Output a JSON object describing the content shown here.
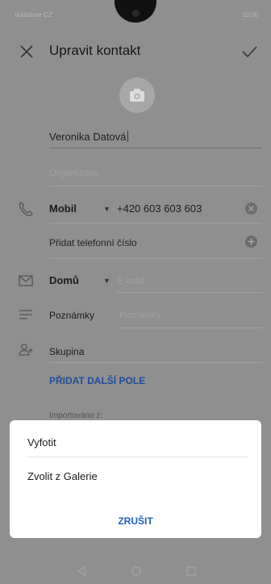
{
  "status": {
    "left_text": "Vodafone CZ",
    "right_text": "10:00"
  },
  "appbar": {
    "title": "Upravit kontakt"
  },
  "form": {
    "name_value": "Veronika Datová",
    "organization_placeholder": "Organizace",
    "phone": {
      "type_label": "Mobil",
      "value": "+420 603 603 603"
    },
    "add_phone_label": "Přidat telefonní číslo",
    "email": {
      "type_label": "Domů",
      "placeholder": "E-mail"
    },
    "notes": {
      "label": "Poznámky",
      "placeholder": "Poznámky"
    },
    "group_label": "Skupina",
    "add_field_label": "PŘIDAT DALŠÍ POLE",
    "imported_label": "Importováno z:"
  },
  "sheet": {
    "items": [
      {
        "label": "Vyfotit"
      },
      {
        "label": "Zvolit z Galerie"
      }
    ],
    "cancel_label": "ZRUŠIT"
  },
  "colors": {
    "accent": "#1f5fbf",
    "dim_bg": "#8f8f8f"
  },
  "icons": [
    "close-icon",
    "check-icon",
    "camera-icon",
    "phone-icon",
    "clear-icon",
    "add-icon",
    "mail-icon",
    "notes-icon",
    "group-icon",
    "back-icon",
    "home-icon",
    "recents-icon"
  ]
}
